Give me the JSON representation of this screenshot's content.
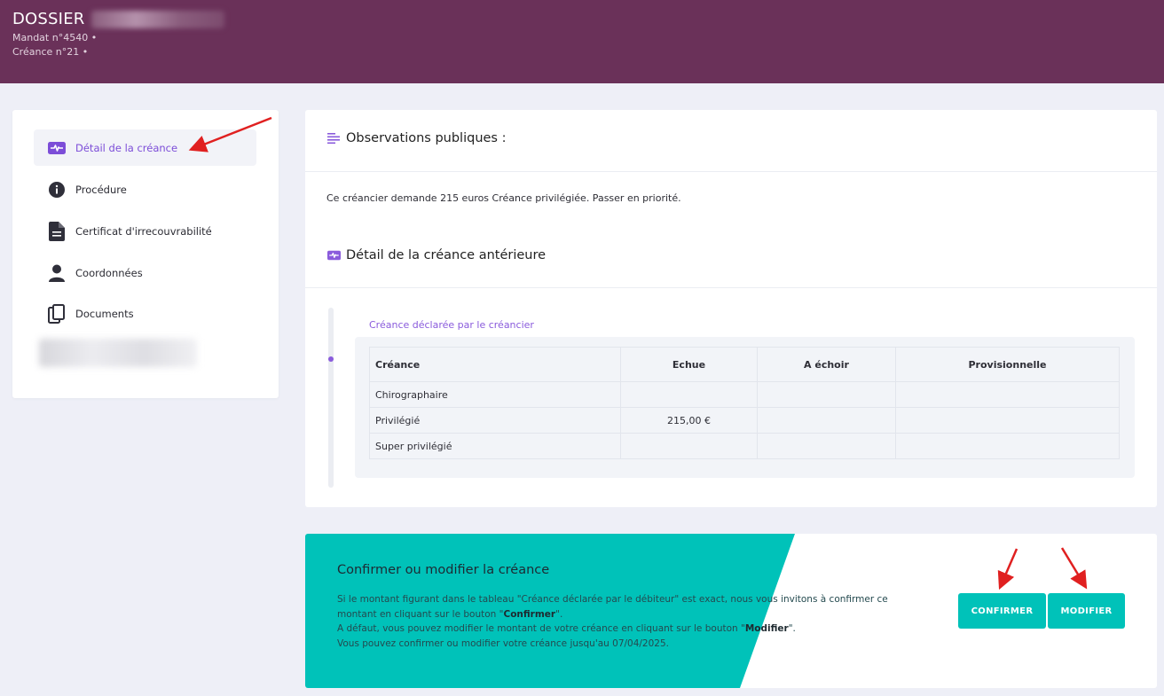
{
  "header": {
    "title": "DOSSIER",
    "mandat": "Mandat n°4540 •",
    "creance": "Créance n°21 •"
  },
  "sidebar": {
    "items": [
      {
        "label": "Détail de la créance",
        "icon": "pulse-icon",
        "active": true
      },
      {
        "label": "Procédure",
        "icon": "info-icon",
        "active": false
      },
      {
        "label": "Certificat d'irrecouvrabilité",
        "icon": "document-icon",
        "active": false
      },
      {
        "label": "Coordonnées",
        "icon": "user-icon",
        "active": false
      },
      {
        "label": "Documents",
        "icon": "copy-icon",
        "active": false
      }
    ]
  },
  "main": {
    "observations_title": "Observations publiques :",
    "observations_text": "Ce créancier demande 215 euros Créance privilégiée. Passer en priorité.",
    "detail_title": "Détail de la créance antérieure",
    "timeline_label": "Créance déclarée par le créancier",
    "table": {
      "headers": [
        "Créance",
        "Echue",
        "A échoir",
        "Provisionnelle"
      ],
      "rows": [
        [
          "Chirographaire",
          "",
          "",
          ""
        ],
        [
          "Privilégié",
          "215,00 €",
          "",
          ""
        ],
        [
          "Super privilégié",
          "",
          "",
          ""
        ]
      ]
    }
  },
  "confirm": {
    "title": "Confirmer ou modifier la créance",
    "line1a": "Si le montant figurant dans le tableau \"Créance déclarée par le débiteur\" est exact, nous vous invitons à confirmer ce",
    "line1b_pre": "montant en cliquant sur le bouton \"",
    "line1b_bold": "Confirmer",
    "line1b_post": "\".",
    "line2_pre": "A défaut, vous pouvez modifier le montant de votre créance en cliquant sur le bouton \"",
    "line2_bold": "Modifier",
    "line2_post": "\".",
    "line3": "Vous pouvez confirmer ou modifier votre créance jusqu'au 07/04/2025.",
    "confirm_button": "CONFIRMER",
    "modify_button": "MODIFIER"
  },
  "colors": {
    "header_bg": "#6a3159",
    "accent_purple": "#8a5bdc",
    "teal": "#00c2b9",
    "annotation_red": "#e02020"
  }
}
